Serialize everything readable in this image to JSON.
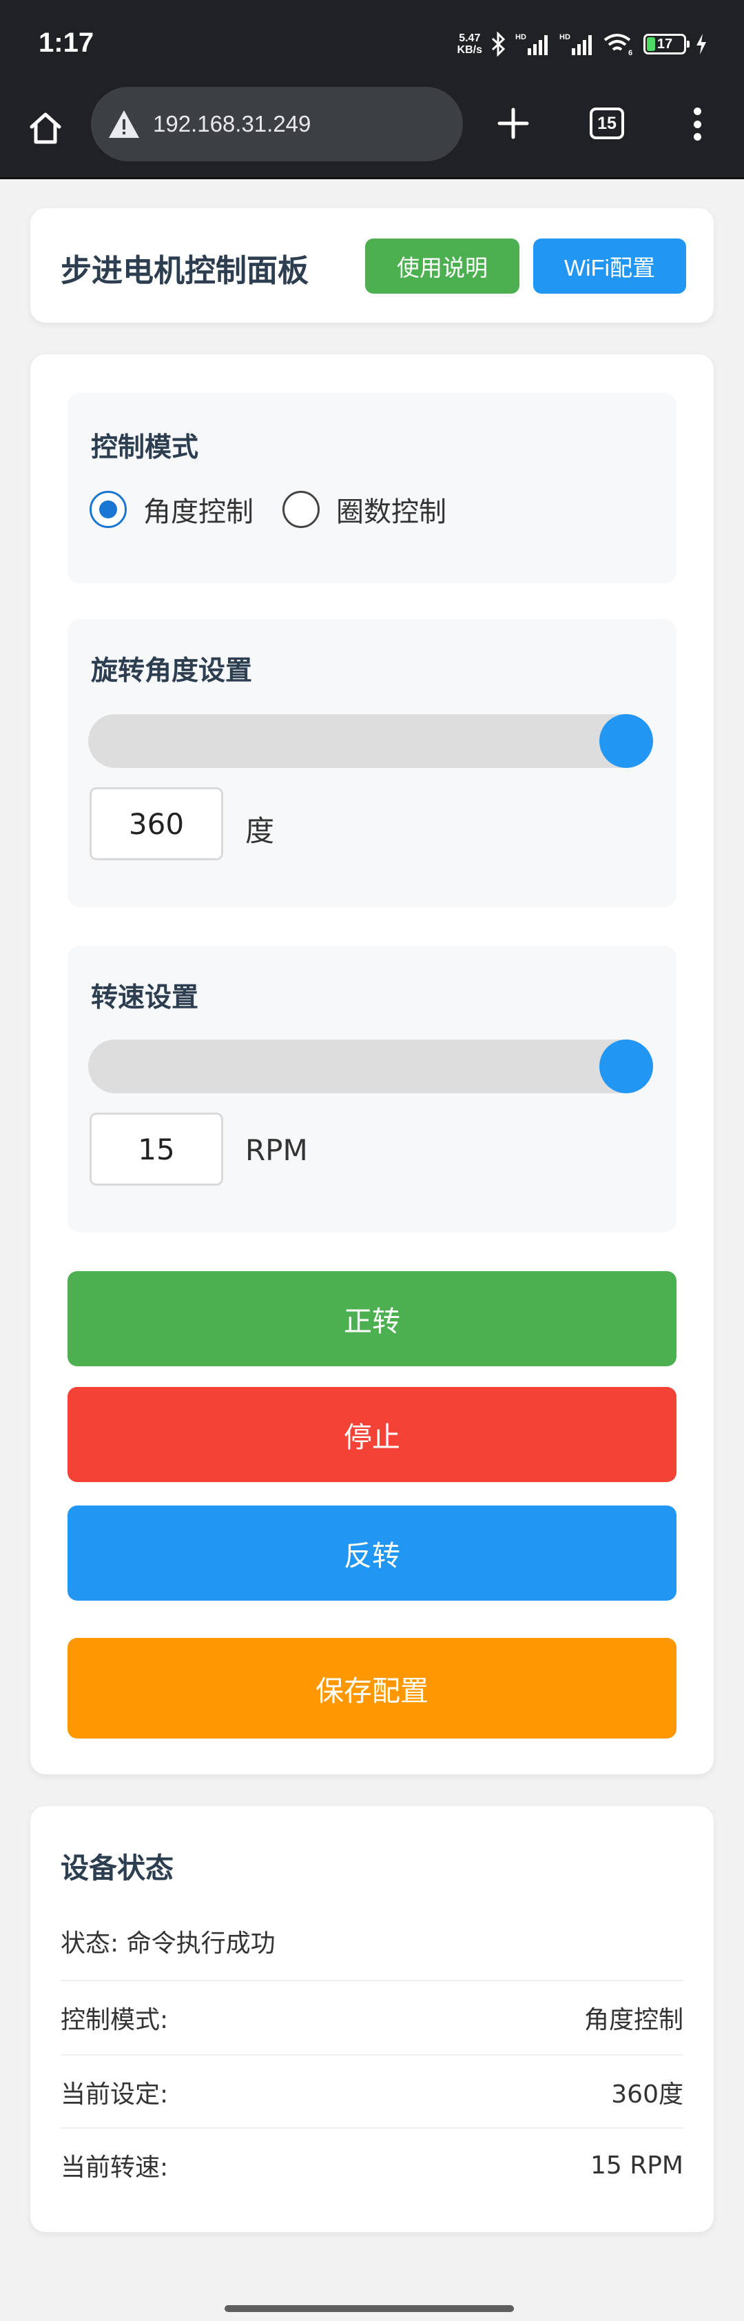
{
  "status_bar": {
    "time": "1:17",
    "net_speed_value": "5.47",
    "net_speed_unit": "KB/s",
    "hd1": "HD",
    "hd2": "HD",
    "wifi_badge": "6",
    "battery": "17"
  },
  "browser": {
    "url": "192.168.31.249",
    "tab_count": "15"
  },
  "header": {
    "title": "步进电机控制面板",
    "help_label": "使用说明",
    "wifi_label": "WiFi配置"
  },
  "control": {
    "mode_title": "控制模式",
    "mode_options": [
      {
        "label": "角度控制",
        "checked": true
      },
      {
        "label": "圈数控制",
        "checked": false
      }
    ],
    "angle": {
      "title": "旋转角度设置",
      "value": "360",
      "unit": "度",
      "slider_fraction": 1.0
    },
    "speed": {
      "title": "转速设置",
      "value": "15",
      "unit": "RPM",
      "slider_fraction": 1.0
    },
    "buttons": {
      "forward": "正转",
      "stop": "停止",
      "reverse": "反转",
      "save": "保存配置"
    }
  },
  "status": {
    "title": "设备状态",
    "message": "状态: 命令执行成功",
    "rows": [
      {
        "label": "控制模式:",
        "value": "角度控制"
      },
      {
        "label": "当前设定:",
        "value": "360度"
      },
      {
        "label": "当前转速:",
        "value": "15 RPM"
      }
    ]
  },
  "colors": {
    "green": "#4caf50",
    "red": "#f44336",
    "blue": "#2196f3",
    "orange": "#ff9800",
    "title": "#2c3e50"
  },
  "icons": [
    "home-icon",
    "warning-icon",
    "plus-icon",
    "tab-switcher-icon",
    "more-vert-icon",
    "bluetooth-icon",
    "signal-icon",
    "wifi-icon",
    "battery-icon",
    "charging-icon"
  ]
}
